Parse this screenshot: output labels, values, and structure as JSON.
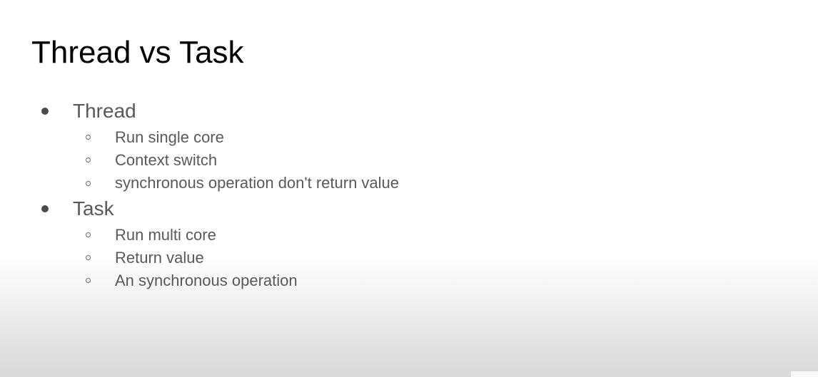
{
  "slide": {
    "title": "Thread vs Task",
    "bullets": [
      {
        "label": "Thread",
        "items": [
          "Run single core",
          "Context switch",
          "synchronous operation don't return value"
        ]
      },
      {
        "label": "Task",
        "items": [
          "Run multi core",
          "Return value",
          "An synchronous operation"
        ]
      }
    ]
  }
}
